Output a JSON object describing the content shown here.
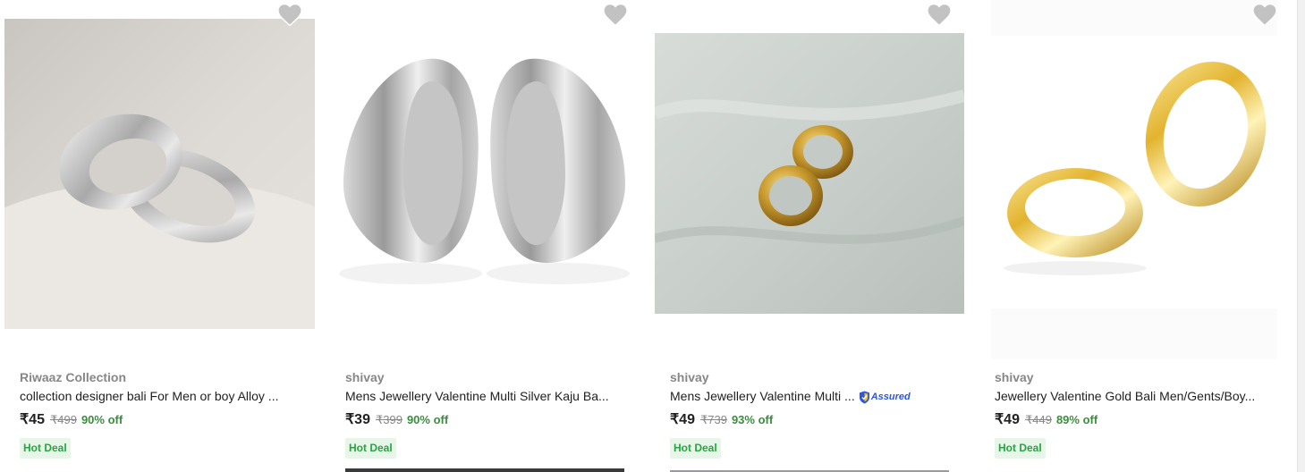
{
  "products": [
    {
      "brand": "Riwaaz Collection",
      "title": "collection designer bali For Men or boy Alloy ...",
      "price": "₹45",
      "mrp": "₹499",
      "discount": "90% off",
      "deal": "Hot Deal",
      "assured": false,
      "image": "silver-hoop-earrings-on-cloth"
    },
    {
      "brand": "shivay",
      "title": "Mens Jewellery Valentine Multi Silver Kaju Ba...",
      "price": "₹39",
      "mrp": "₹399",
      "discount": "90% off",
      "deal": "Hot Deal",
      "assured": false,
      "image": "silver-hoop-earrings-pair"
    },
    {
      "brand": "shivay",
      "title": "Mens Jewellery Valentine Multi ...",
      "price": "₹49",
      "mrp": "₹739",
      "discount": "93% off",
      "deal": "Hot Deal",
      "assured": true,
      "assured_label": "Assured",
      "image": "gold-small-hoops-on-fabric"
    },
    {
      "brand": "shivay",
      "title": "Jewellery Valentine Gold Bali Men/Gents/Boy...",
      "price": "₹49",
      "mrp": "₹449",
      "discount": "89% off",
      "deal": "Hot Deal",
      "assured": false,
      "image": "gold-hoop-earrings-pair"
    }
  ],
  "icons": {
    "wishlist": "heart-icon",
    "assured": "assured-shield-icon"
  },
  "colors": {
    "discount": "#388e3c",
    "deal_bg": "#e8f5e9",
    "deal_text": "#26a541",
    "wishlist": "#c2c2c2",
    "assured": "#2a55e5"
  }
}
